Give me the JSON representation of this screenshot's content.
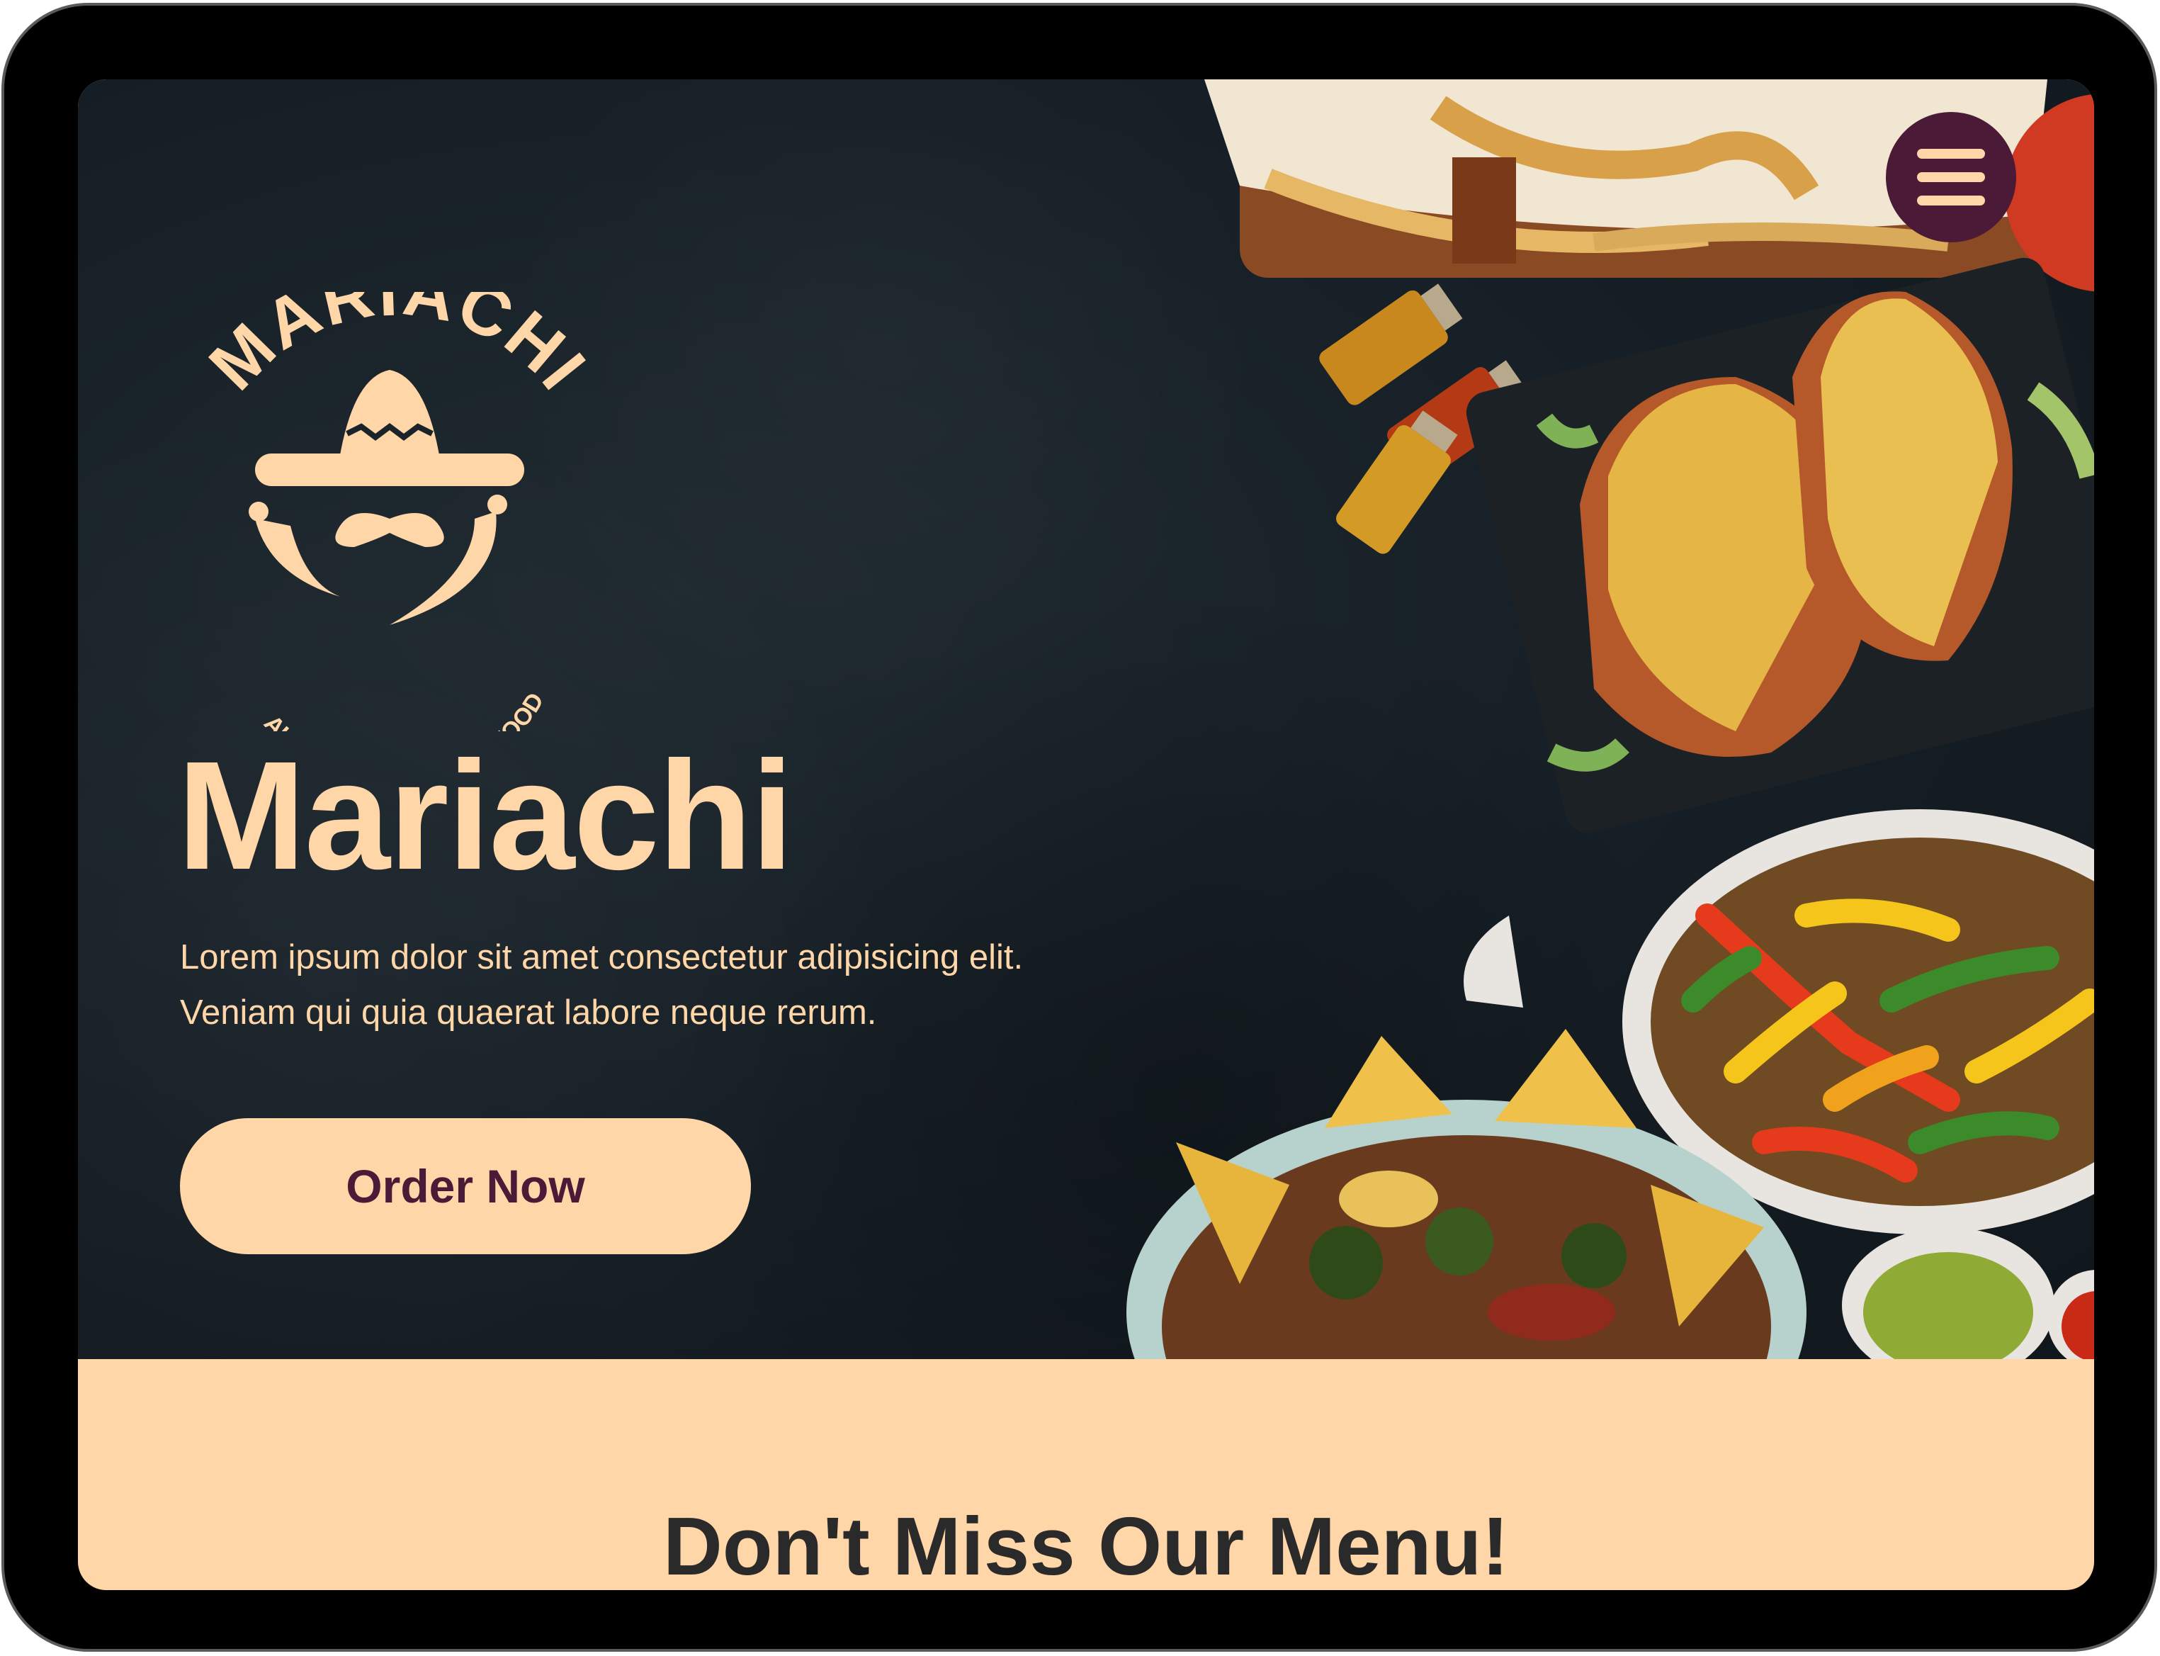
{
  "brand": {
    "logo_arc_text": "MARIACHI",
    "logo_tagline": "AUTHENTIC MEXICAN FOOD",
    "title": "Mariachi"
  },
  "hero": {
    "description": "Lorem ipsum dolor sit amet consectetur adipisicing elit. Veniam qui quia quaerat labore neque rerum.",
    "cta_label": "Order Now"
  },
  "nav": {
    "menu_icon": "hamburger-menu-icon"
  },
  "menu_section": {
    "title": "Don't Miss Our Menu!"
  },
  "colors": {
    "accent": "#ffd6a8",
    "brand_dark": "#4a1a36",
    "hero_bg": "#172027",
    "section_bg": "#ffd6a8",
    "heading_text": "#2a2a2a"
  }
}
